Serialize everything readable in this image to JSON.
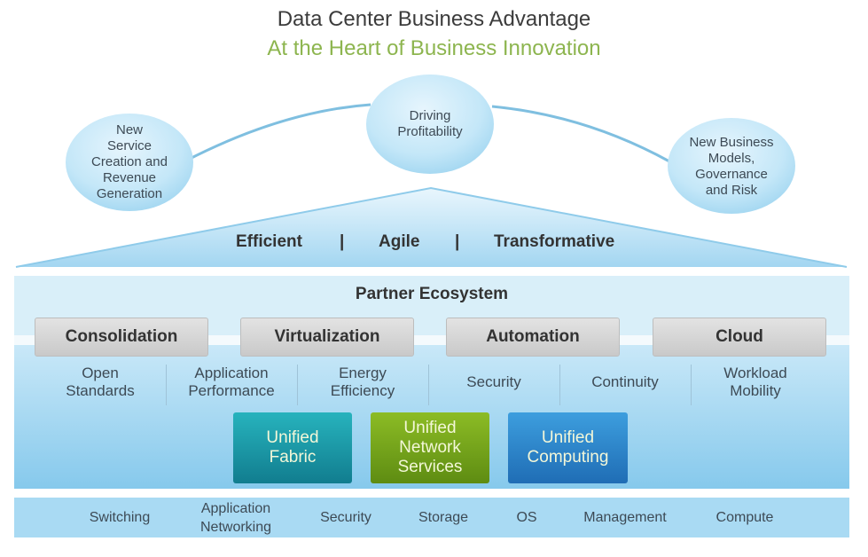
{
  "header": {
    "title": "Data Center Business Advantage",
    "subtitle": "At the Heart of Business Innovation"
  },
  "colors": {
    "title": "#3c3c3c",
    "subtitle": "#8db54f",
    "light_blue": "#d8eef9",
    "mid_blue": "#a9daf3",
    "teal": "#1a9aa6",
    "green": "#76a31c",
    "blue": "#2f86cc"
  },
  "bubbles": [
    {
      "label": "New Service Creation and Revenue Generation",
      "lines": [
        "New",
        "Service",
        "Creation and",
        "Revenue",
        "Generation"
      ]
    },
    {
      "label": "Driving Profitability",
      "lines": [
        "Driving",
        "Profitability"
      ]
    },
    {
      "label": "New Business Models, Governance and Risk",
      "lines": [
        "New Business",
        "Models,",
        "Governance",
        "and Risk"
      ]
    }
  ],
  "roof": {
    "items": [
      "Efficient",
      "Agile",
      "Transformative"
    ],
    "separator": "|"
  },
  "ecosystem": {
    "title": "Partner Ecosystem",
    "pillars": [
      "Consolidation",
      "Virtualization",
      "Automation",
      "Cloud"
    ],
    "features": [
      {
        "lines": [
          "Open",
          "Standards"
        ]
      },
      {
        "lines": [
          "Application",
          "Performance"
        ]
      },
      {
        "lines": [
          "Energy",
          "Efficiency"
        ]
      },
      {
        "lines": [
          "Security"
        ]
      },
      {
        "lines": [
          "Continuity"
        ]
      },
      {
        "lines": [
          "Workload",
          "Mobility"
        ]
      }
    ],
    "unified": [
      {
        "lines": [
          "Unified",
          "Fabric"
        ]
      },
      {
        "lines": [
          "Unified",
          "Network",
          "Services"
        ]
      },
      {
        "lines": [
          "Unified",
          "Computing"
        ]
      }
    ]
  },
  "foundation": [
    {
      "lines": [
        "Switching"
      ]
    },
    {
      "lines": [
        "Application",
        "Networking"
      ]
    },
    {
      "lines": [
        "Security"
      ]
    },
    {
      "lines": [
        "Storage"
      ]
    },
    {
      "lines": [
        "OS"
      ]
    },
    {
      "lines": [
        "Management"
      ]
    },
    {
      "lines": [
        "Compute"
      ]
    }
  ]
}
